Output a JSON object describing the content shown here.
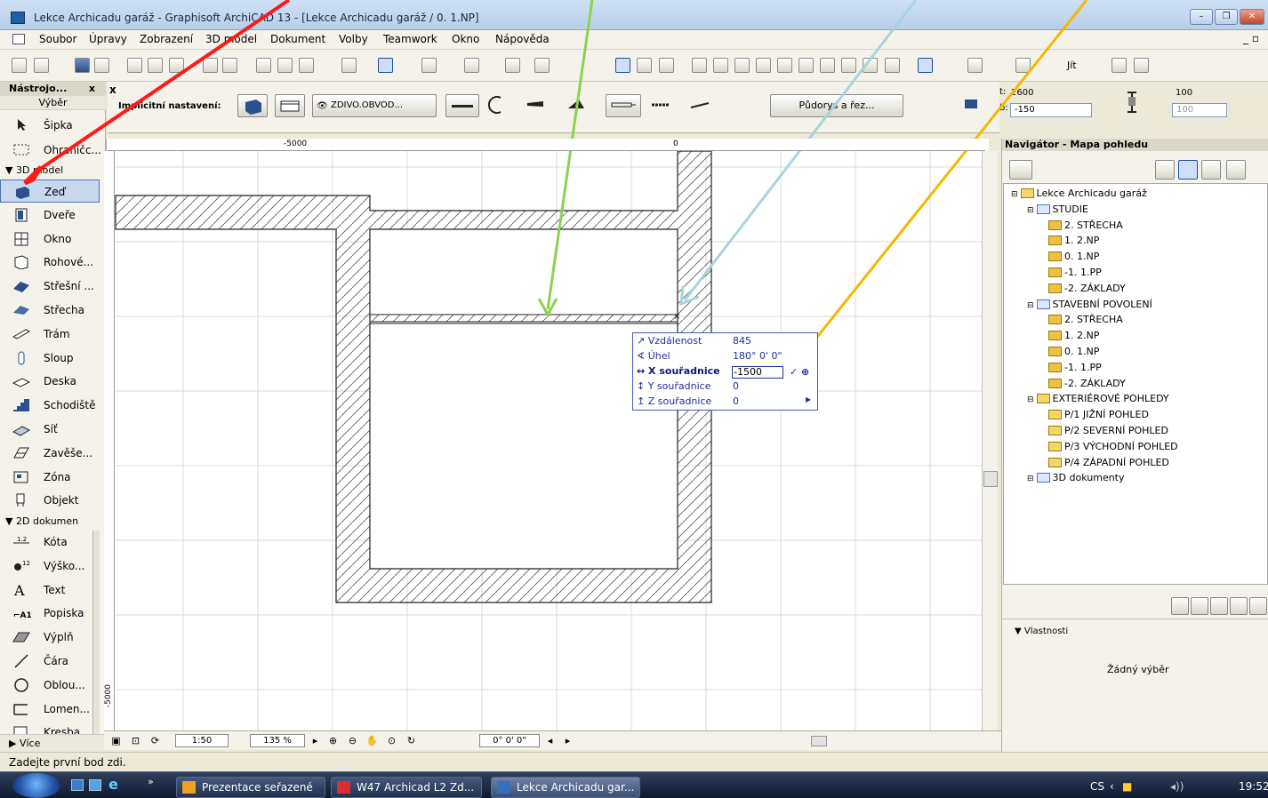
{
  "window": {
    "title": "Lekce Archicadu garáž - Graphisoft ArchiCAD 13 - [Lekce Archicadu garáž / 0. 1.NP]"
  },
  "menu": [
    "Soubor",
    "Úpravy",
    "Zobrazení",
    "3D model",
    "Dokument",
    "Volby",
    "Teamwork",
    "Okno",
    "Nápověda"
  ],
  "toolbar": {
    "jit_label": "Jít"
  },
  "toolbox": {
    "title": "Nástrojo...",
    "close": "x",
    "selection_label": "Výběr",
    "tools_top": [
      {
        "label": "Šipka",
        "icon": "arrow-icon"
      },
      {
        "label": "Ohraničc...",
        "icon": "marquee-icon"
      }
    ],
    "section_3d": "3D model",
    "tools_3d": [
      {
        "label": "Zeď",
        "icon": "wall-icon"
      },
      {
        "label": "Dveře",
        "icon": "door-icon"
      },
      {
        "label": "Okno",
        "icon": "window-icon"
      },
      {
        "label": "Rohové...",
        "icon": "corner-window-icon"
      },
      {
        "label": "Střešní ...",
        "icon": "skylight-icon"
      },
      {
        "label": "Střecha",
        "icon": "roof-icon"
      },
      {
        "label": "Trám",
        "icon": "beam-icon"
      },
      {
        "label": "Sloup",
        "icon": "column-icon"
      },
      {
        "label": "Deska",
        "icon": "slab-icon"
      },
      {
        "label": "Schodiště",
        "icon": "stair-icon"
      },
      {
        "label": "Síť",
        "icon": "mesh-icon"
      },
      {
        "label": "Zavěše...",
        "icon": "curtain-wall-icon"
      },
      {
        "label": "Zóna",
        "icon": "zone-icon"
      },
      {
        "label": "Objekt",
        "icon": "object-icon"
      }
    ],
    "section_2d": "2D dokumen",
    "tools_2d": [
      {
        "label": "Kóta",
        "icon": "dimension-icon"
      },
      {
        "label": "Výško...",
        "icon": "level-dimension-icon"
      },
      {
        "label": "Text",
        "icon": "text-icon"
      },
      {
        "label": "Popiska",
        "icon": "label-icon"
      },
      {
        "label": "Výplň",
        "icon": "fill-icon"
      },
      {
        "label": "Čára",
        "icon": "line-icon"
      },
      {
        "label": "Oblou...",
        "icon": "arc-icon"
      },
      {
        "label": "Lomen...",
        "icon": "polyline-icon"
      },
      {
        "label": "Kresba",
        "icon": "drawing-icon"
      }
    ],
    "more": "Více"
  },
  "info": {
    "close": "x",
    "default_label": "Implicitní nastavení:",
    "composite": "ZDIVO.OBVOD...",
    "floorplan_btn": "Půdorys a řez...",
    "height_top": "2600",
    "height_bottom": "-150",
    "t_label": "t:",
    "b_label": "b:",
    "thick_1": "100",
    "thick_2": "100"
  },
  "canvas": {
    "ruler_top_left": "-5000",
    "ruler_top_zero": "0",
    "ruler_left": "-5000"
  },
  "tracker": {
    "rows": [
      {
        "label": "Vzdálenost",
        "value": "845",
        "icon": "distance-icon"
      },
      {
        "label": "Úhel",
        "value": "180° 0' 0\"",
        "icon": "angle-icon"
      },
      {
        "label": "X souřadnice",
        "value": "-1500",
        "icon": "x-coord-icon"
      },
      {
        "label": "Y souřadnice",
        "value": "0",
        "icon": "y-coord-icon"
      },
      {
        "label": "Z souřadnice",
        "value": "0",
        "icon": "z-coord-icon"
      }
    ]
  },
  "bottom": {
    "scale": "1:50",
    "zoom": "135 %",
    "angle": "0° 0' 0\""
  },
  "navigator": {
    "title": "Navigátor - Mapa pohledu",
    "tree": [
      {
        "label": "Lekce Archicadu garáž",
        "level": 0,
        "kind": "project"
      },
      {
        "label": "STUDIE",
        "level": 1,
        "kind": "set"
      },
      {
        "label": "2. STŘECHA",
        "level": 2,
        "kind": "story"
      },
      {
        "label": "1. 2.NP",
        "level": 2,
        "kind": "story"
      },
      {
        "label": "0. 1.NP",
        "level": 2,
        "kind": "story"
      },
      {
        "label": "-1. 1.PP",
        "level": 2,
        "kind": "story"
      },
      {
        "label": "-2. ZÁKLADY",
        "level": 2,
        "kind": "story"
      },
      {
        "label": "STAVEBNÍ POVOLENÍ",
        "level": 1,
        "kind": "set"
      },
      {
        "label": "2. STŘECHA",
        "level": 2,
        "kind": "story"
      },
      {
        "label": "1. 2.NP",
        "level": 2,
        "kind": "story"
      },
      {
        "label": "0. 1.NP",
        "level": 2,
        "kind": "story"
      },
      {
        "label": "-1. 1.PP",
        "level": 2,
        "kind": "story"
      },
      {
        "label": "-2. ZÁKLADY",
        "level": 2,
        "kind": "story"
      },
      {
        "label": "EXTERIÉROVÉ POHLEDY",
        "level": 1,
        "kind": "elev"
      },
      {
        "label": "P/1 JIŽNÍ POHLED",
        "level": 2,
        "kind": "elev"
      },
      {
        "label": "P/2 SEVERNÍ POHLED",
        "level": 2,
        "kind": "elev"
      },
      {
        "label": "P/3 VÝCHODNÍ POHLED",
        "level": 2,
        "kind": "elev"
      },
      {
        "label": "P/4 ZÁPADNÍ POHLED",
        "level": 2,
        "kind": "elev"
      },
      {
        "label": "3D dokumenty",
        "level": 1,
        "kind": "doc3d"
      }
    ],
    "props_label": "Vlastnosti",
    "no_selection": "Žádný výběr"
  },
  "status": "Zadejte první bod zdi.",
  "taskbar": {
    "buttons": [
      "Prezentace seřazené",
      "W47 Archicad L2 Zd...",
      "Lekce Archicadu gar..."
    ],
    "lang": "CS",
    "time": "19:52"
  },
  "colors": {
    "arrow_red": "#ff1a1a",
    "arrow_green": "#8dd14f",
    "arrow_blue": "#a9d4dc",
    "arrow_orange": "#f5b800",
    "tracker_border": "#4b5bb0"
  }
}
